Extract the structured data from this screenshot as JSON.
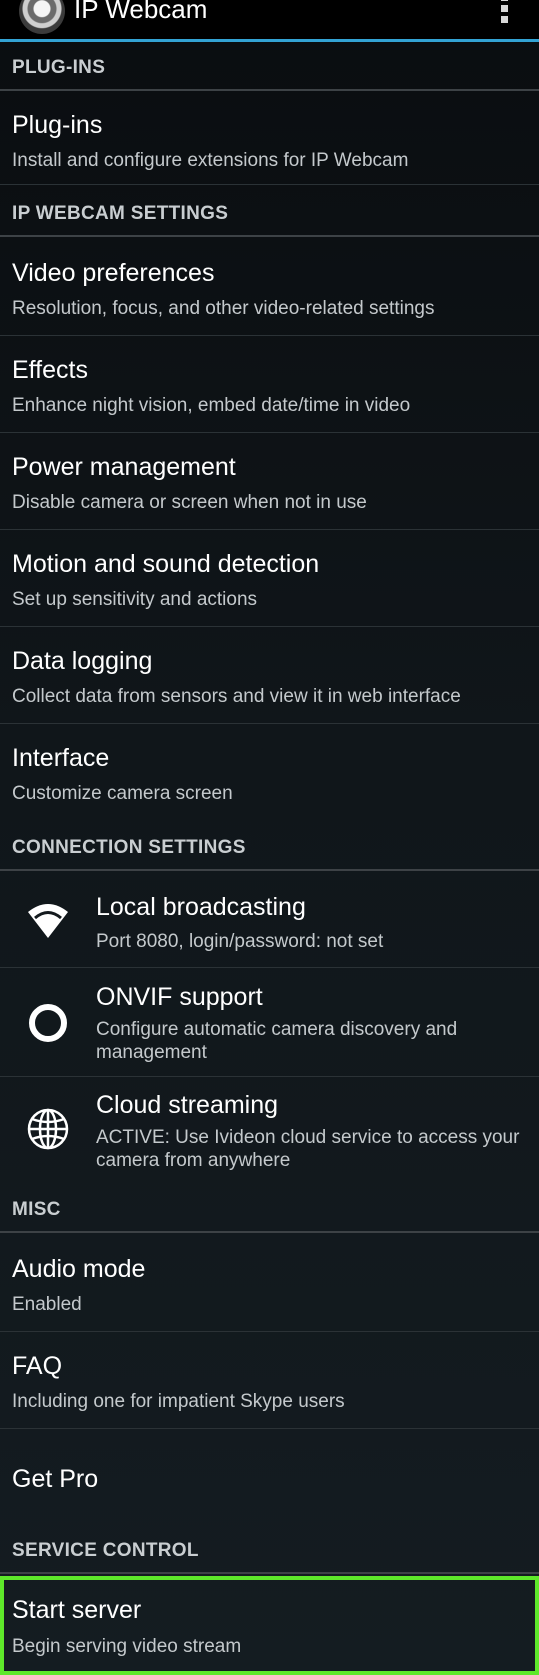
{
  "app": {
    "title": "IP Webcam",
    "icon": "camera-lens-icon",
    "menu_icon": "overflow-menu-icon",
    "accent_color": "#33a3d4"
  },
  "sections": {
    "plugins": {
      "header": "PLUG-INS"
    },
    "settings": {
      "header": "IP WEBCAM SETTINGS"
    },
    "connection": {
      "header": "CONNECTION SETTINGS"
    },
    "misc": {
      "header": "MISC"
    },
    "service": {
      "header": "SERVICE CONTROL"
    }
  },
  "items": {
    "plugins": {
      "title": "Plug-ins",
      "summary": "Install and configure extensions for IP Webcam"
    },
    "video": {
      "title": "Video preferences",
      "summary": "Resolution, focus, and other video-related settings"
    },
    "effects": {
      "title": "Effects",
      "summary": "Enhance night vision, embed date/time in video"
    },
    "power": {
      "title": "Power management",
      "summary": "Disable camera or screen when not in use"
    },
    "motion": {
      "title": "Motion and sound detection",
      "summary": "Set up sensitivity and actions"
    },
    "logging": {
      "title": "Data logging",
      "summary": "Collect data from sensors and view it in web interface"
    },
    "interface": {
      "title": "Interface",
      "summary": "Customize camera screen"
    },
    "local": {
      "title": "Local broadcasting",
      "summary": "Port 8080, login/password: not set",
      "icon": "wifi-icon"
    },
    "onvif": {
      "title": "ONVIF support",
      "summary": "Configure automatic camera discovery and management",
      "icon": "ring-icon"
    },
    "cloud": {
      "title": "Cloud streaming",
      "summary": "ACTIVE: Use Ivideon cloud service to access your camera from anywhere",
      "icon": "globe-icon"
    },
    "audio": {
      "title": "Audio mode",
      "summary": "Enabled"
    },
    "faq": {
      "title": "FAQ",
      "summary": "Including one for impatient Skype users"
    },
    "pro": {
      "title": "Get Pro"
    },
    "start": {
      "title": "Start server",
      "summary": "Begin serving video stream",
      "highlight_color": "#5ee82a"
    }
  }
}
